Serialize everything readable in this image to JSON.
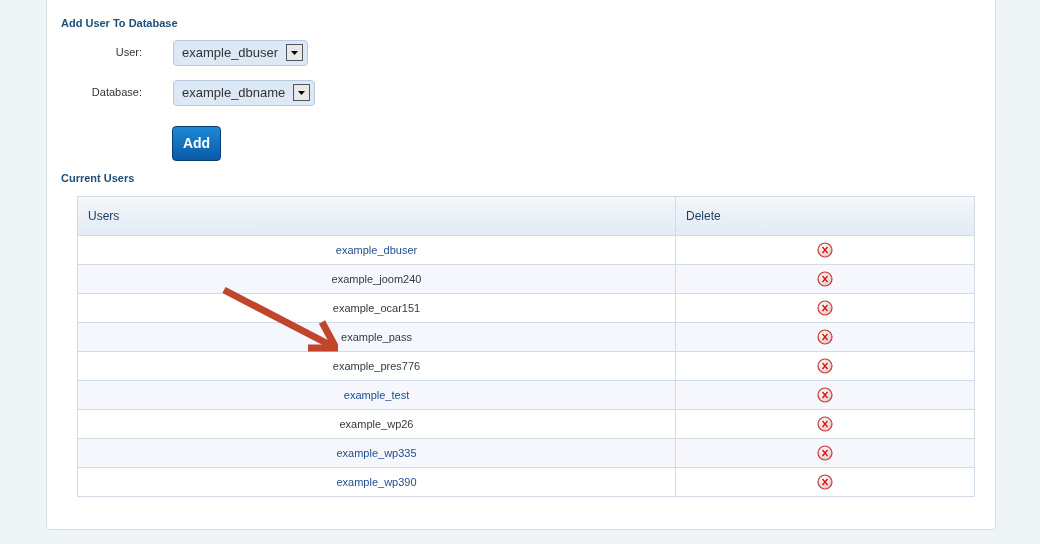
{
  "form": {
    "title": "Add User To Database",
    "fields": [
      {
        "label": "User:",
        "value": "example_dbuser"
      },
      {
        "label": "Database:",
        "value": "example_dbname"
      }
    ],
    "button": "Add"
  },
  "current_users": {
    "title": "Current Users",
    "columns": [
      "Users",
      "Delete"
    ],
    "rows": [
      {
        "user": "example_dbuser",
        "visited": false
      },
      {
        "user": "example_joom240",
        "visited": true
      },
      {
        "user": "example_ocar151",
        "visited": true
      },
      {
        "user": "example_pass",
        "visited": true
      },
      {
        "user": "example_pres776",
        "visited": true
      },
      {
        "user": "example_test",
        "visited": false
      },
      {
        "user": "example_wp26",
        "visited": true
      },
      {
        "user": "example_wp335",
        "visited": false
      },
      {
        "user": "example_wp390",
        "visited": false
      }
    ]
  }
}
